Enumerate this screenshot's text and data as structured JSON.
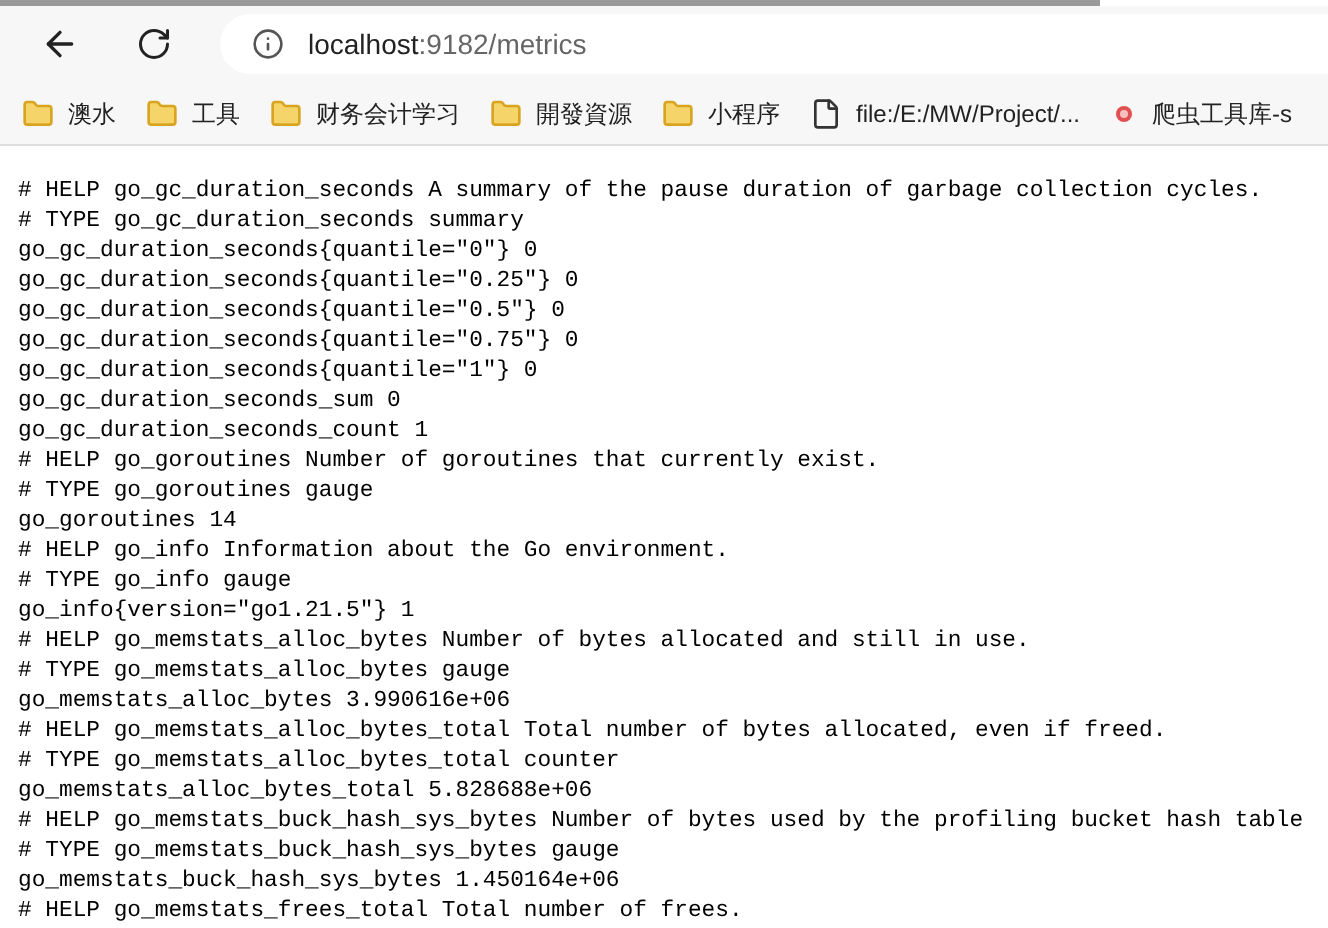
{
  "address_bar": {
    "host": "localhost",
    "path": ":9182/metrics"
  },
  "bookmarks": [
    {
      "kind": "folder",
      "label": "澳水"
    },
    {
      "kind": "folder",
      "label": "工具"
    },
    {
      "kind": "folder",
      "label": "财务会计学习"
    },
    {
      "kind": "folder",
      "label": "開發資源"
    },
    {
      "kind": "folder",
      "label": "小程序"
    },
    {
      "kind": "file",
      "label": "file:/E:/MW/Project/..."
    },
    {
      "kind": "site",
      "label": "爬虫工具库-s"
    }
  ],
  "page_lines": [
    "# HELP go_gc_duration_seconds A summary of the pause duration of garbage collection cycles.",
    "# TYPE go_gc_duration_seconds summary",
    "go_gc_duration_seconds{quantile=\"0\"} 0",
    "go_gc_duration_seconds{quantile=\"0.25\"} 0",
    "go_gc_duration_seconds{quantile=\"0.5\"} 0",
    "go_gc_duration_seconds{quantile=\"0.75\"} 0",
    "go_gc_duration_seconds{quantile=\"1\"} 0",
    "go_gc_duration_seconds_sum 0",
    "go_gc_duration_seconds_count 1",
    "# HELP go_goroutines Number of goroutines that currently exist.",
    "# TYPE go_goroutines gauge",
    "go_goroutines 14",
    "# HELP go_info Information about the Go environment.",
    "# TYPE go_info gauge",
    "go_info{version=\"go1.21.5\"} 1",
    "# HELP go_memstats_alloc_bytes Number of bytes allocated and still in use.",
    "# TYPE go_memstats_alloc_bytes gauge",
    "go_memstats_alloc_bytes 3.990616e+06",
    "# HELP go_memstats_alloc_bytes_total Total number of bytes allocated, even if freed.",
    "# TYPE go_memstats_alloc_bytes_total counter",
    "go_memstats_alloc_bytes_total 5.828688e+06",
    "# HELP go_memstats_buck_hash_sys_bytes Number of bytes used by the profiling bucket hash table",
    "# TYPE go_memstats_buck_hash_sys_bytes gauge",
    "go_memstats_buck_hash_sys_bytes 1.450164e+06",
    "# HELP go_memstats_frees_total Total number of frees."
  ]
}
